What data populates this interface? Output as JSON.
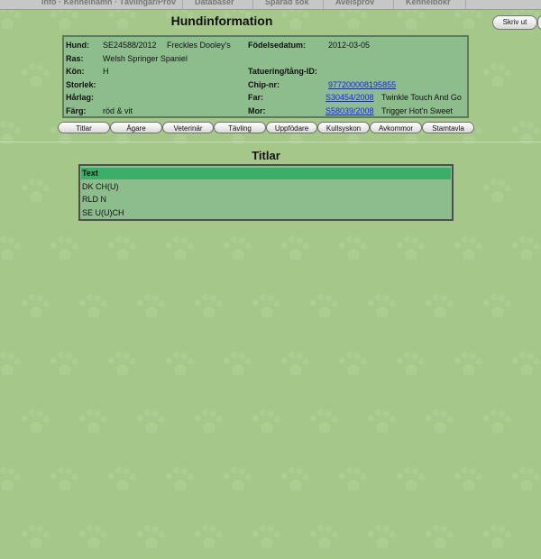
{
  "top_nav": [
    "Info · Kennelnamn · Tävlingar/Prov",
    "Databaser",
    "Sparad sök",
    "Avelsprov",
    "Kennelbokr"
  ],
  "page_title": "Hundinformation",
  "print_label": "Skriv ut",
  "dog": {
    "hund_label": "Hund:",
    "reg_nr": "SE24588/2012",
    "name": "Freckles Dooley's",
    "ras_label": "Ras:",
    "breed": "Welsh Springer Spaniel",
    "kon_label": "Kön:",
    "sex": "H",
    "storlek_label": "Storlek:",
    "harlag_label": "Hårlag:",
    "farg_label": "Färg:",
    "color": "röd & vit",
    "fodelse_label": "Födelsedatum:",
    "birth_date": "2012-03-05",
    "tatuering_label": "Tatuering/tång-ID:",
    "chip_label": "Chip-nr:",
    "chip": "977200008195855",
    "far_label": "Far:",
    "sire_reg": "S30454/2008",
    "sire_name": "Twinkle Touch And Go",
    "mor_label": "Mor:",
    "dam_reg": "S58039/2008",
    "dam_name": "Trigger Hot'n Sweet"
  },
  "tabs": [
    "Titlar",
    "Ägare",
    "Veterinär",
    "Tävling",
    "Uppfödare",
    "Kullsyskon",
    "Avkommor",
    "Stamtavla"
  ],
  "section_title": "Titlar",
  "titles_table": {
    "header": "Text",
    "rows": [
      "DK CH(U)",
      "RLD N",
      "SE U(U)CH"
    ]
  }
}
